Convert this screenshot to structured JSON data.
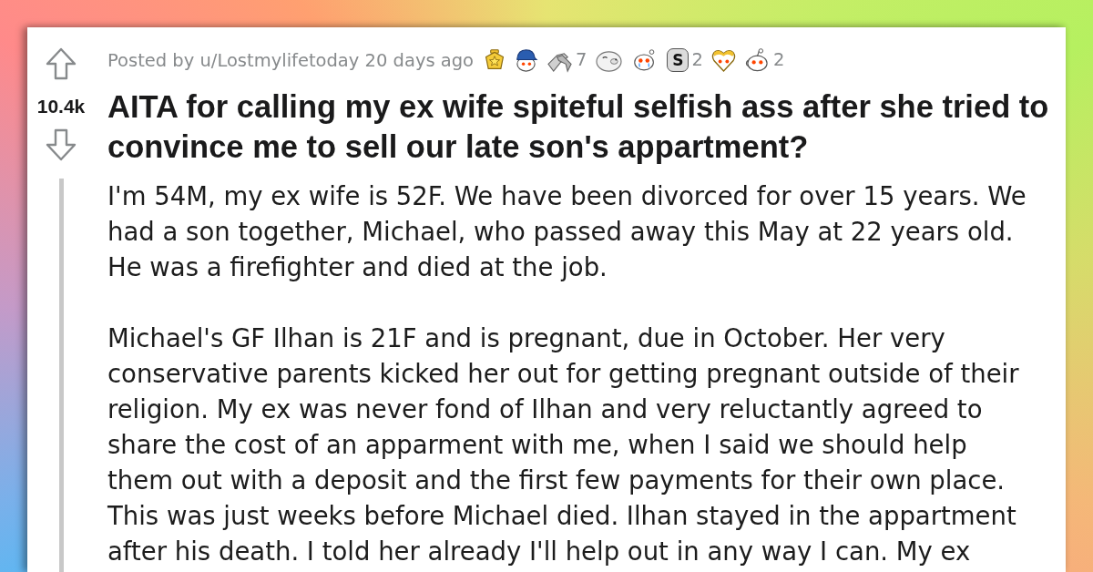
{
  "post": {
    "vote": {
      "score": "10.4k"
    },
    "meta": "Posted by u/Lostmylifetoday 20 days ago",
    "awards": [
      {
        "kind": "medal"
      },
      {
        "kind": "cap"
      },
      {
        "kind": "handshake",
        "count": "7"
      },
      {
        "kind": "seal"
      },
      {
        "kind": "crying"
      },
      {
        "kind": "coin",
        "label": "S",
        "count": "2"
      },
      {
        "kind": "heart"
      },
      {
        "kind": "mascot",
        "count": "2"
      }
    ],
    "title": "AITA for calling my ex wife spiteful selfish ass after she tried to convince me to sell our late son's appartment?",
    "body": [
      "I'm 54M, my ex wife is 52F. We have been divorced for over 15 years. We had a son together, Michael, who passed away this May at 22 years old. He was a firefighter and died at the job.",
      "Michael's GF Ilhan is 21F and is pregnant, due in October. Her very conservative parents kicked her out for getting pregnant outside of their religion. My ex was never fond of Ilhan and very reluctantly agreed to share the cost of an apparment with me, when I said we should help them out with a deposit and the first few payments for their own place. This was just weeks before Michael died. Ilhan stayed in the appartment after his death. I told her already I'll help out in any way I can. My ex"
    ]
  }
}
